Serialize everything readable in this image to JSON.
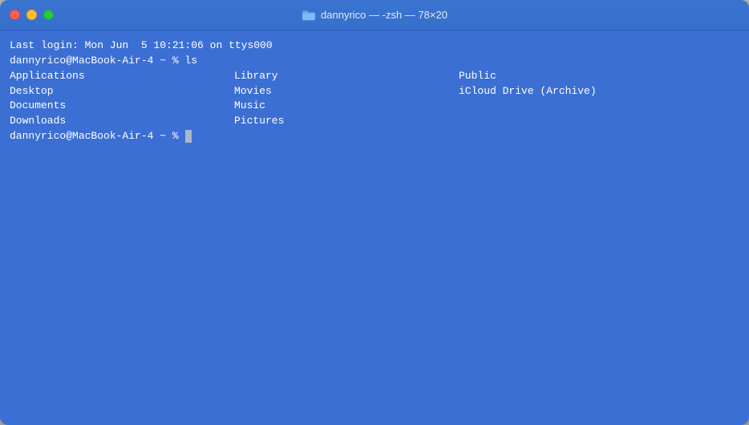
{
  "window": {
    "title": "dannyrico — -zsh — 78×20",
    "traffic": {
      "close": "close",
      "minimize": "minimize",
      "maximize": "maximize"
    }
  },
  "terminal": {
    "login_line": "Last login: Mon Jun  5 10:21:06 on ttys000",
    "prompt1": "dannyrico@MacBook-Air-4 ~ % ls",
    "prompt2": "dannyrico@MacBook-Air-4 ~ % ",
    "ls_items": {
      "col1": [
        "Applications",
        "Desktop",
        "Documents",
        "Downloads"
      ],
      "col2": [
        "Library",
        "Movies",
        "Music",
        "Pictures"
      ],
      "col3": [
        "Public",
        "iCloud Drive (Archive)"
      ]
    }
  }
}
